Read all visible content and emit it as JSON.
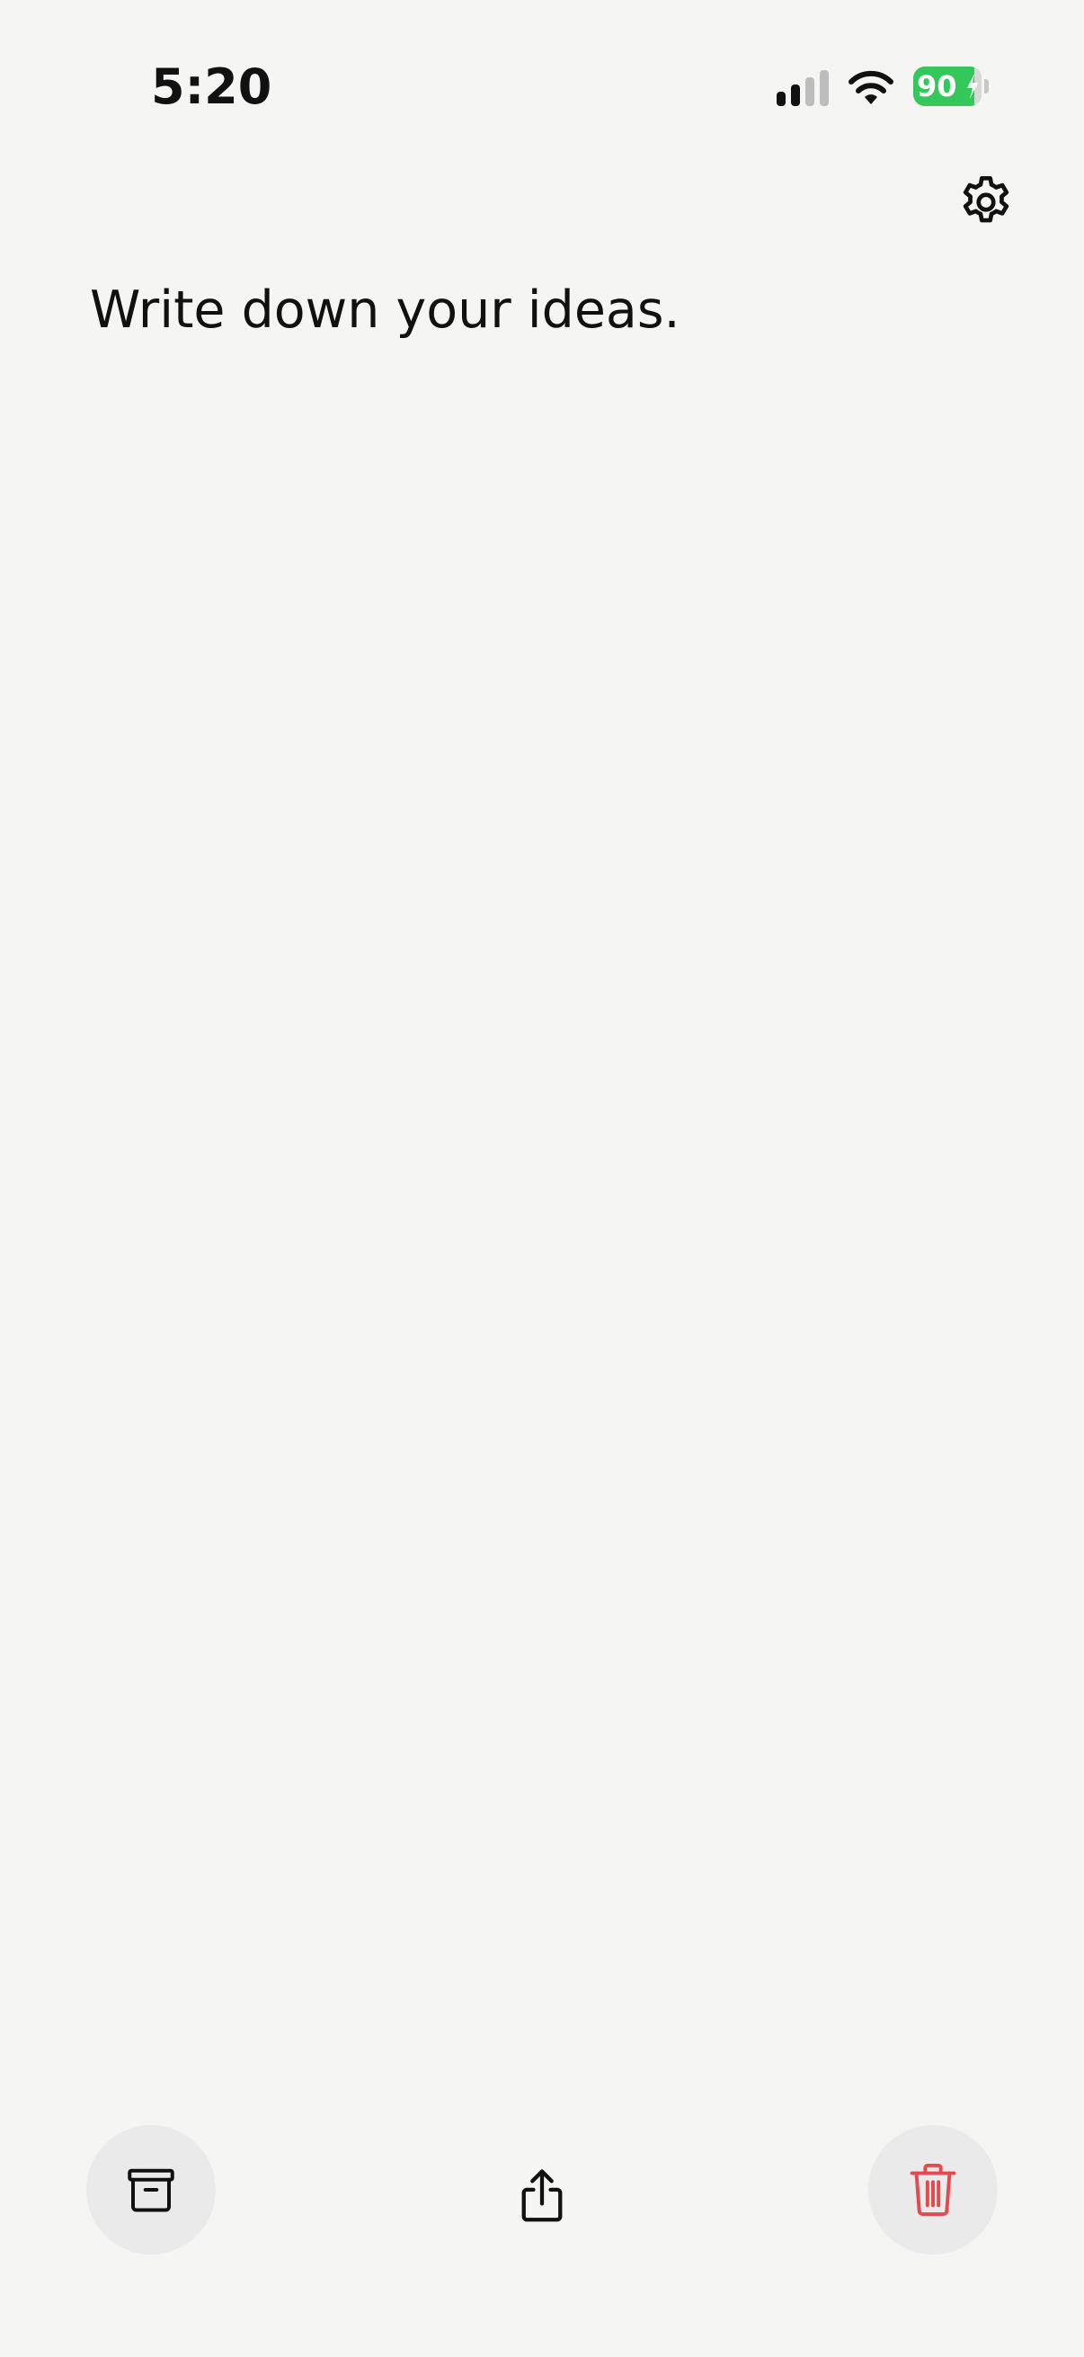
{
  "status_bar": {
    "time": "5:20",
    "battery_level": "90",
    "battery_fill": 0.9,
    "battery_color": "#34c759",
    "signal_icon": "cellular-signal-icon",
    "wifi_icon": "wifi-icon",
    "charging_icon": "bolt-icon"
  },
  "header": {
    "settings_icon": "gear-icon"
  },
  "editor": {
    "placeholder": "Write down your ideas.",
    "value": ""
  },
  "toolbar": {
    "archive_icon": "archive-box-icon",
    "share_icon": "share-icon",
    "delete_icon": "trash-icon",
    "delete_color": "#e5484d"
  }
}
